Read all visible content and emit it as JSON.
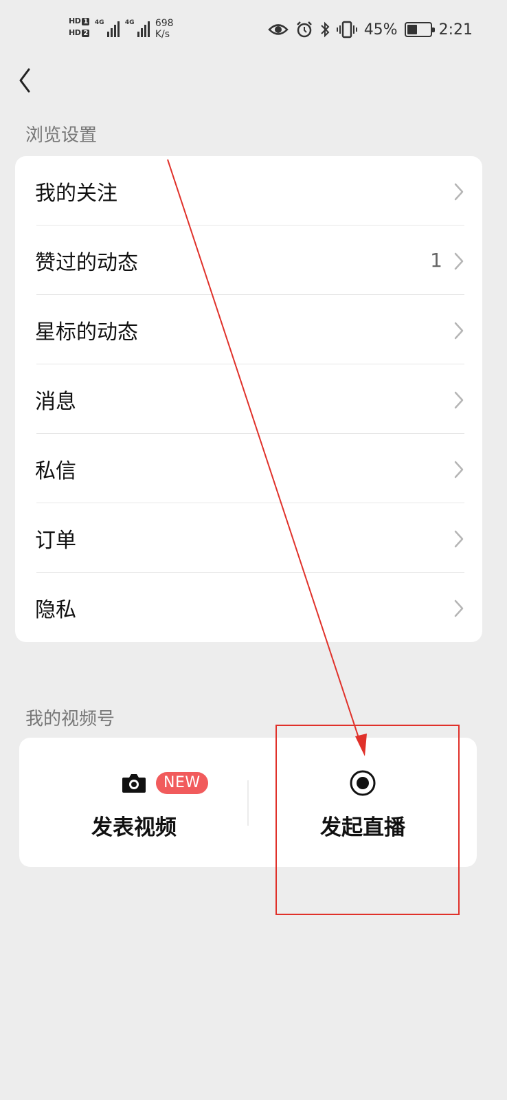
{
  "status_bar": {
    "hd1": "HD",
    "hd1_sim": "1",
    "hd2": "HD",
    "hd2_sim": "2",
    "net1": "4G",
    "net2": "4G",
    "speed_value": "698",
    "speed_unit": "K/s",
    "battery_percent": "45%",
    "battery_level": 0.45,
    "time": "2:21",
    "icons": [
      "eye-icon",
      "alarm-icon",
      "bluetooth-icon",
      "vibrate-icon"
    ]
  },
  "browse_section": {
    "title": "浏览设置",
    "items": [
      {
        "label": "我的关注",
        "count": ""
      },
      {
        "label": "赞过的动态",
        "count": "1"
      },
      {
        "label": "星标的动态",
        "count": ""
      },
      {
        "label": "消息",
        "count": ""
      },
      {
        "label": "私信",
        "count": ""
      },
      {
        "label": "订单",
        "count": ""
      },
      {
        "label": "隐私",
        "count": ""
      }
    ]
  },
  "channels_section": {
    "title": "我的视频号",
    "post_video": {
      "label": "发表视频",
      "badge": "NEW",
      "icon": "camera-icon"
    },
    "go_live": {
      "label": "发起直播",
      "icon": "record-icon"
    }
  },
  "colors": {
    "background": "#ededed",
    "card": "#ffffff",
    "badge": "#f15b5c",
    "annotation": "#e0312a"
  }
}
